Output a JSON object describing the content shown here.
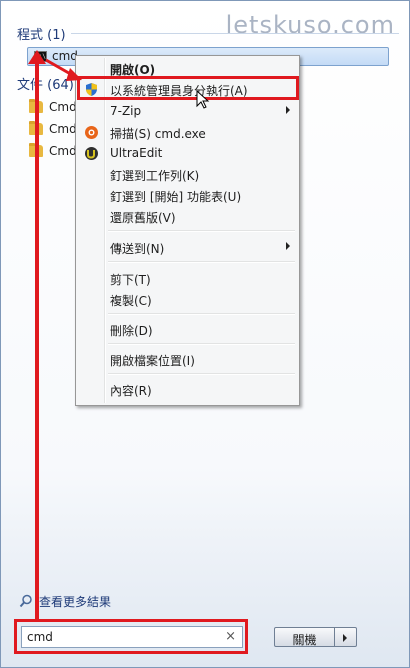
{
  "watermark": "letskuso.com",
  "programs": {
    "header": "程式 (1)",
    "item": "cmd"
  },
  "documents": {
    "header": "文件 (64)",
    "items": [
      "Cmd",
      "Cmd",
      "Cmd"
    ]
  },
  "context_menu": {
    "open": "開啟(O)",
    "run_as_admin": "以系統管理員身分執行(A)",
    "zip": "7-Zip",
    "scan": "掃描(S) cmd.exe",
    "ultraedit": "UltraEdit",
    "pin_taskbar": "釘選到工作列(K)",
    "pin_start": "釘選到 [開始] 功能表(U)",
    "restore_prev": "還原舊版(V)",
    "send_to": "傳送到(N)",
    "cut": "剪下(T)",
    "copy": "複製(C)",
    "delete": "刪除(D)",
    "open_location": "開啟檔案位置(I)",
    "properties": "內容(R)"
  },
  "see_more": "查看更多結果",
  "search": {
    "value": "cmd",
    "clear": "×"
  },
  "shutdown": {
    "label": "關機"
  },
  "colors": {
    "highlight": "#e0191f",
    "accent": "#1e3a78"
  }
}
